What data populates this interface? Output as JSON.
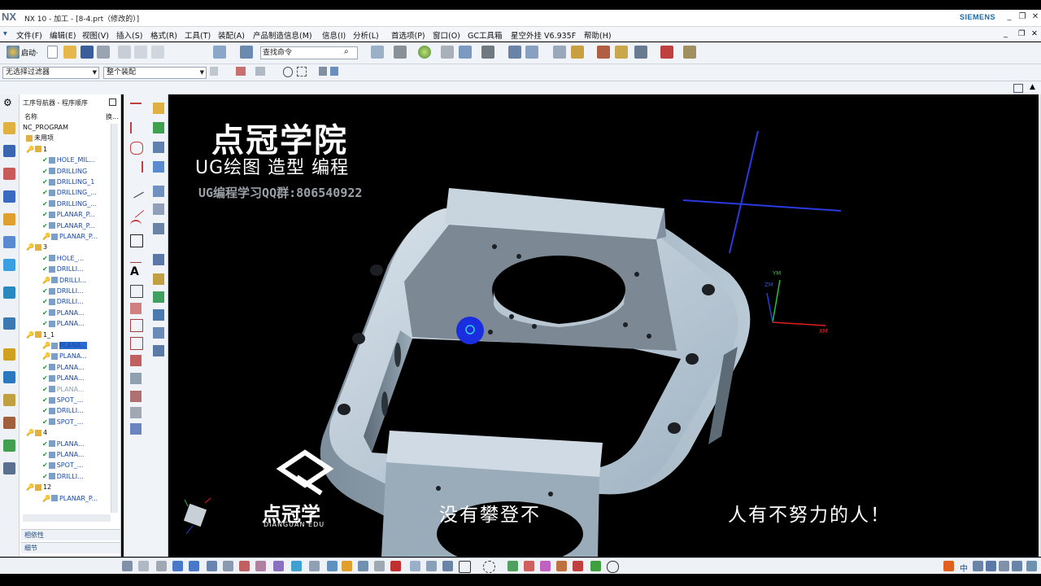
{
  "window": {
    "logo": "NX",
    "title": "NX 10 - 加工 - [8-4.prt（修改的）]",
    "brand": "SIEMENS"
  },
  "menu": {
    "items": [
      "文件(F)",
      "编辑(E)",
      "视图(V)",
      "插入(S)",
      "格式(R)",
      "工具(T)",
      "装配(A)",
      "产品制造信息(M)",
      "信息(I)",
      "分析(L)",
      "首选项(P)",
      "窗口(O)",
      "GC工具箱",
      "星空外挂 V6.935F",
      "帮助(H)"
    ]
  },
  "toolbar": {
    "start_label": "启动·",
    "command_search_placeholder": "查找命令"
  },
  "filters": {
    "selection_filter": "无选择过滤器",
    "assembly_scope": "整个装配"
  },
  "navigator": {
    "title": "工序导航器 - 程序顺序",
    "col_name": "名称",
    "col_change": "换...",
    "rows": [
      {
        "indent": 0,
        "label": "NC_PROGRAM",
        "type": "root"
      },
      {
        "indent": 1,
        "label": "未用项",
        "type": "group"
      },
      {
        "indent": 1,
        "label": "1",
        "type": "program"
      },
      {
        "indent": 2,
        "label": "HOLE_MIL...",
        "type": "op",
        "status": "ok"
      },
      {
        "indent": 2,
        "label": "DRILLING",
        "type": "op",
        "status": "ok"
      },
      {
        "indent": 2,
        "label": "DRILLING_1",
        "type": "op",
        "status": "ok"
      },
      {
        "indent": 2,
        "label": "DRILLING_...",
        "type": "op",
        "status": "ok"
      },
      {
        "indent": 2,
        "label": "DRILLING_...",
        "type": "op",
        "status": "ok"
      },
      {
        "indent": 2,
        "label": "PLANAR_P...",
        "type": "op",
        "status": "ok"
      },
      {
        "indent": 2,
        "label": "PLANAR_P...",
        "type": "op",
        "status": "ok"
      },
      {
        "indent": 2,
        "label": "PLANAR_P...",
        "type": "op",
        "status": "key"
      },
      {
        "indent": 1,
        "label": "3",
        "type": "program"
      },
      {
        "indent": 2,
        "label": "HOLE_...",
        "type": "op",
        "status": "ok"
      },
      {
        "indent": 2,
        "label": "DRILLI...",
        "type": "op",
        "status": "ok"
      },
      {
        "indent": 2,
        "label": "DRILLI...",
        "type": "op",
        "status": "key"
      },
      {
        "indent": 2,
        "label": "DRILLI...",
        "type": "op",
        "status": "ok"
      },
      {
        "indent": 2,
        "label": "DRILLI...",
        "type": "op",
        "status": "ok"
      },
      {
        "indent": 2,
        "label": "PLANA...",
        "type": "op",
        "status": "ok"
      },
      {
        "indent": 2,
        "label": "PLANA...",
        "type": "op",
        "status": "ok"
      },
      {
        "indent": 1,
        "label": "1_1",
        "type": "program"
      },
      {
        "indent": 2,
        "label": "PLANA...",
        "type": "op",
        "status": "key",
        "selected": true
      },
      {
        "indent": 2,
        "label": "PLANA...",
        "type": "op",
        "status": "key"
      },
      {
        "indent": 2,
        "label": "PLANA...",
        "type": "op",
        "status": "ok"
      },
      {
        "indent": 2,
        "label": "PLANA...",
        "type": "op",
        "status": "ok"
      },
      {
        "indent": 2,
        "label": "PLANA...",
        "type": "op",
        "status": "ok",
        "grey": true
      },
      {
        "indent": 2,
        "label": "SPOT_...",
        "type": "op",
        "status": "ok"
      },
      {
        "indent": 2,
        "label": "DRILLI...",
        "type": "op",
        "status": "ok"
      },
      {
        "indent": 2,
        "label": "SPOT_...",
        "type": "op",
        "status": "ok"
      },
      {
        "indent": 1,
        "label": "4",
        "type": "program"
      },
      {
        "indent": 2,
        "label": "PLANA...",
        "type": "op",
        "status": "ok"
      },
      {
        "indent": 2,
        "label": "PLANA...",
        "type": "op",
        "status": "ok"
      },
      {
        "indent": 2,
        "label": "SPOT_...",
        "type": "op",
        "status": "ok"
      },
      {
        "indent": 2,
        "label": "DRILLI...",
        "type": "op",
        "status": "ok"
      },
      {
        "indent": 1,
        "label": "12",
        "type": "program"
      },
      {
        "indent": 2,
        "label": "PLANAR_P...",
        "type": "op",
        "status": "key"
      }
    ],
    "panel_dependencies": "相依性",
    "panel_details": "细节"
  },
  "overlay": {
    "academy_title": "点冠学院",
    "academy_tagline": "UG绘图 造型 编程",
    "academy_qq": "UG编程学习QQ群:806540922",
    "subtitle_left": "没有攀登不",
    "subtitle_right": "人有不努力的人！",
    "logo_text": "点冠学",
    "logo_sub": "DIANGUAN EDU"
  },
  "triad": {
    "x_label": "XM",
    "y_label": "YM",
    "z_label": "ZM"
  },
  "colors": {
    "selection": "#2a6bd0",
    "check": "#1a9a2a",
    "key": "#d6a400",
    "part": "#b9c9d6"
  },
  "taskbar": {
    "ime_label": "中"
  }
}
